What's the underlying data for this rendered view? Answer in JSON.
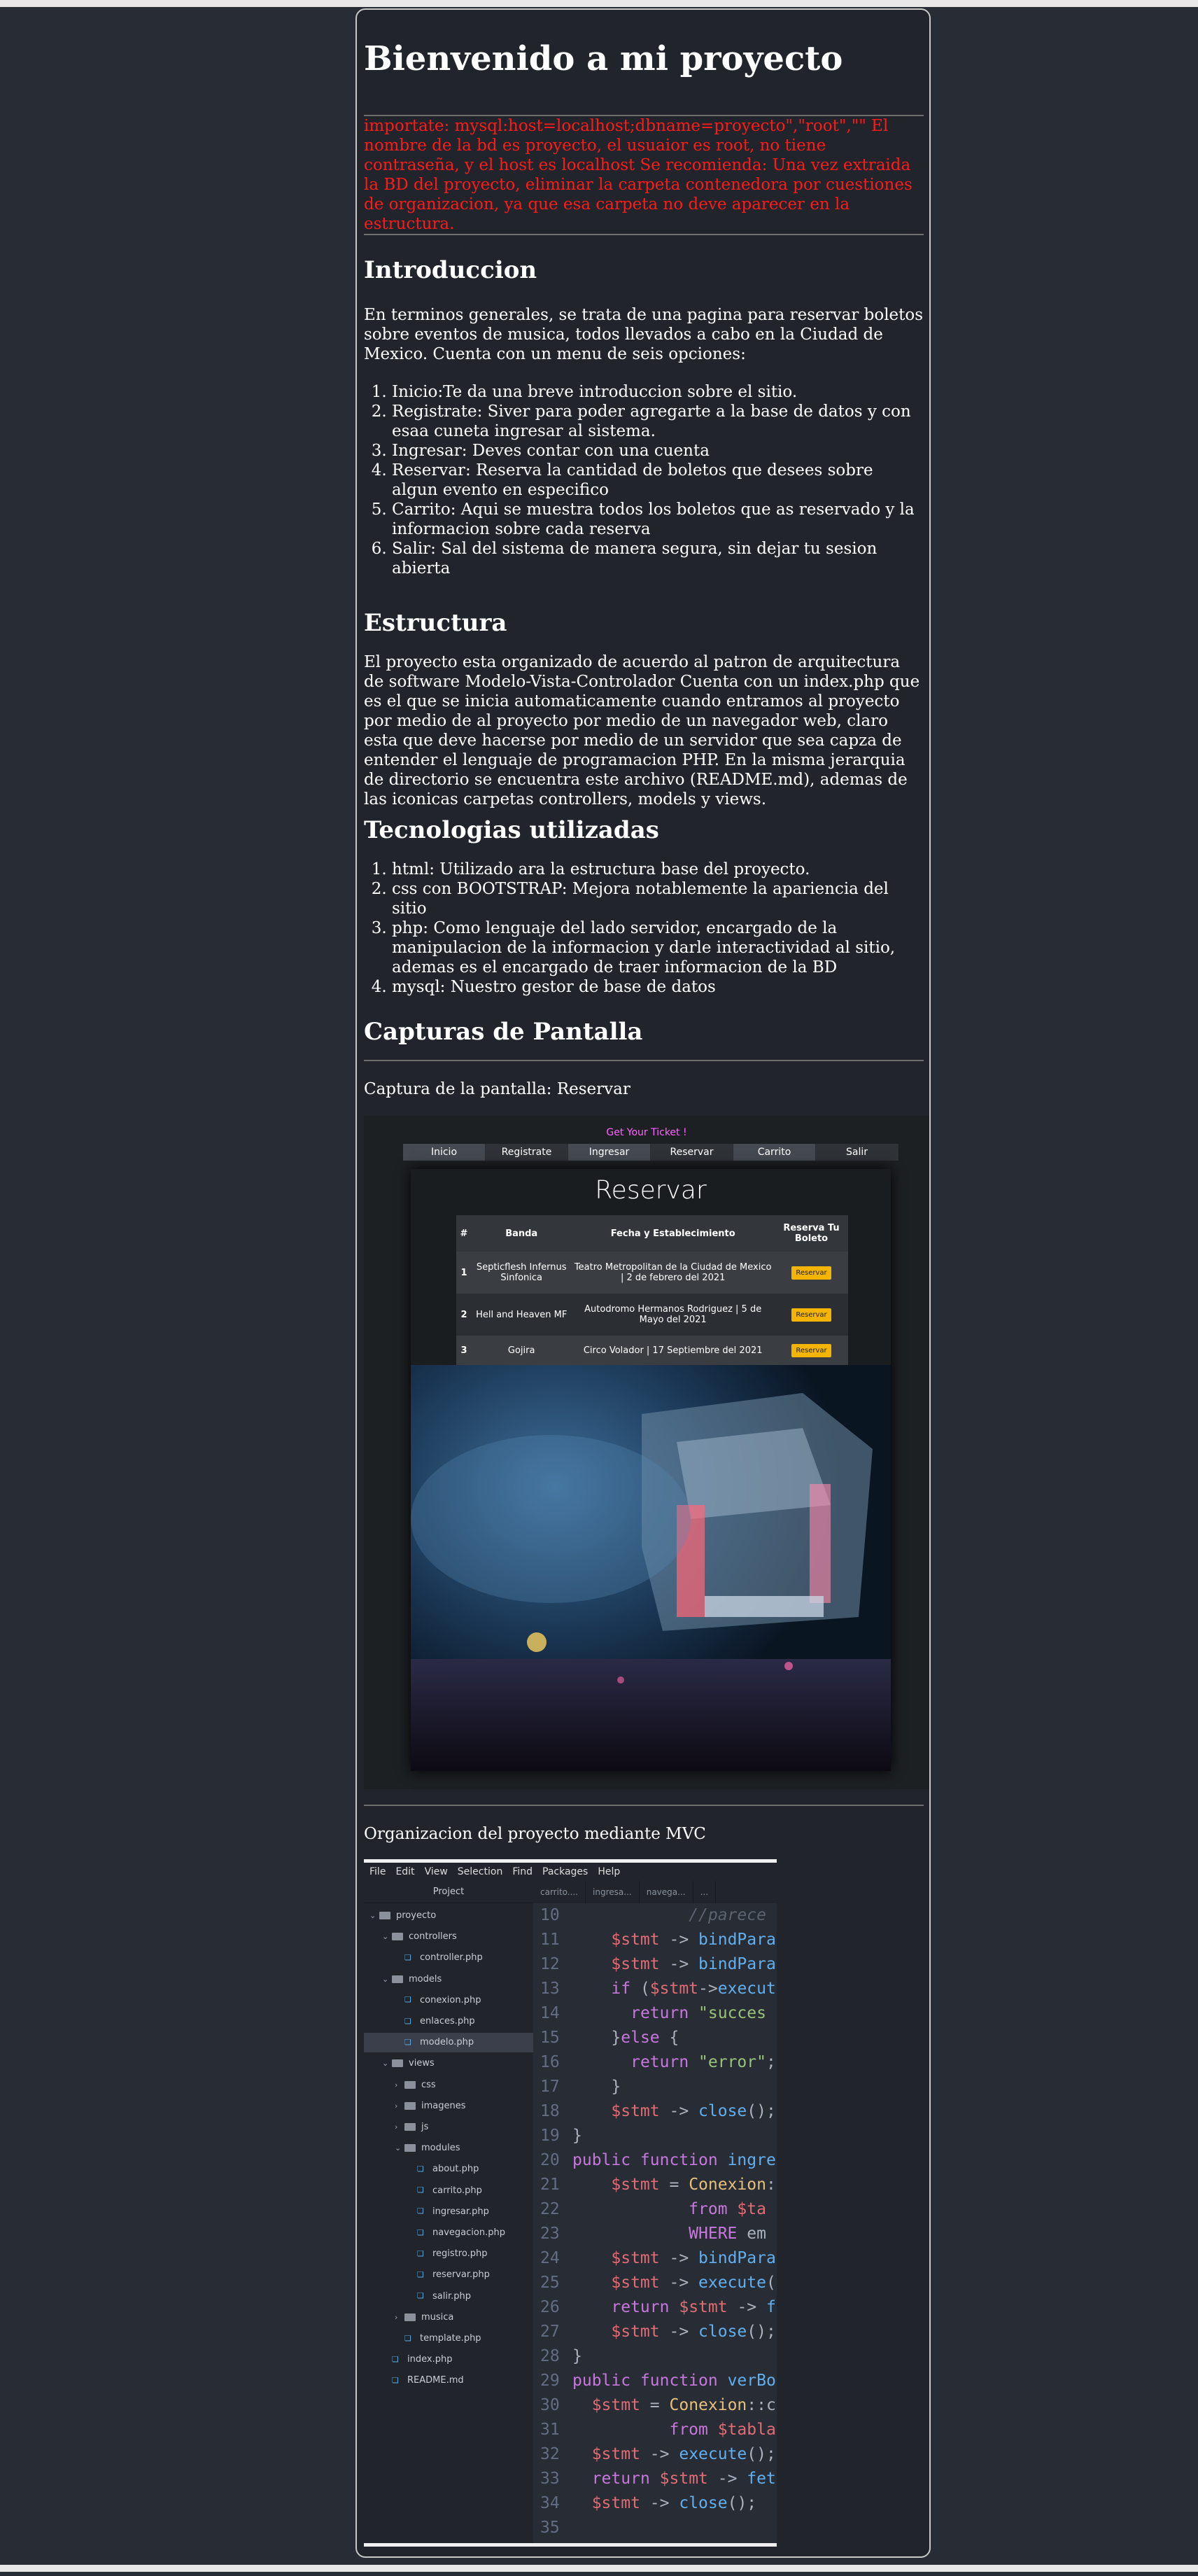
{
  "title": "Bienvenido a mi proyecto",
  "note": "importate: mysql:host=localhost;dbname=proyecto\",\"root\",\"\" El nombre de la bd es proyecto, el usuaior es root, no tiene contraseña, y el host es localhost Se recomienda: Una vez extraida la BD del proyecto, eliminar la carpeta contenedora por cuestiones de organizacion, ya que esa carpeta no deve aparecer en la estructura.",
  "intro": {
    "heading": "Introduccion",
    "text": "En terminos generales, se trata de una pagina para reservar boletos sobre eventos de musica, todos llevados a cabo en la Ciudad de Mexico. Cuenta con un menu de seis opciones:",
    "items": [
      "Inicio:Te da una breve introduccion sobre el sitio.",
      "Registrate: Siver para poder agregarte a la base de datos y con esaa cuneta ingresar al sistema.",
      "Ingresar: Deves contar con una cuenta",
      "Reservar: Reserva la cantidad de boletos que desees sobre algun evento en especifico",
      "Carrito: Aqui se muestra todos los boletos que as reservado y la informacion sobre cada reserva",
      "Salir: Sal del sistema de manera segura, sin dejar tu sesion abierta"
    ]
  },
  "estructura": {
    "heading": "Estructura",
    "text": "El proyecto esta organizado de acuerdo al patron de arquitectura de software Modelo-Vista-Controlador Cuenta con un index.php que es el que se inicia automaticamente cuando entramos al proyecto por medio de al proyecto por medio de un navegador web, claro esta que deve hacerse por medio de un servidor que sea capza de entender el lenguaje de programacion PHP. En la misma jerarquia de directorio se encuentra este archivo (README.md), ademas de las iconicas carpetas controllers, models y views."
  },
  "tecnologias": {
    "heading": "Tecnologias utilizadas",
    "items": [
      "html: Utilizado ara la estructura base del proyecto.",
      "css con BOOTSTRAP: Mejora notablemente la apariencia del sitio",
      "php: Como lenguaje del lado servidor, encargado de la manipulacion de la informacion y darle interactividad al sitio, ademas es el encargado de traer informacion de la BD",
      "mysql: Nuestro gestor de base de datos"
    ]
  },
  "capturas": {
    "heading": "Capturas de Pantalla",
    "caption1": "Captura de la pantalla: Reservar",
    "caption2": "Organizacion del proyecto mediante MVC"
  },
  "reservar_shot": {
    "banner": "Get Your Ticket !",
    "nav": [
      "Inicio",
      "Registrate",
      "Ingresar",
      "Reservar",
      "Carrito",
      "Salir"
    ],
    "title": "Reservar",
    "columns": [
      "#",
      "Banda",
      "Fecha y Establecimiento",
      "Reserva Tu Boleto"
    ],
    "rows": [
      {
        "num": "1",
        "banda": "Septicflesh Infernus Sinfonica",
        "fecha": "Teatro Metropolitan de la Ciudad de Mexico | 2 de febrero del 2021",
        "btn": "Reservar"
      },
      {
        "num": "2",
        "banda": "Hell and Heaven MF",
        "fecha": "Autodromo Hermanos Rodriguez | 5 de Mayo del 2021",
        "btn": "Reservar"
      },
      {
        "num": "3",
        "banda": "Gojira",
        "fecha": "Circo Volador | 17 Septiembre del 2021",
        "btn": "Reservar"
      }
    ],
    "btn_color": "#f4b400"
  },
  "editor_shot": {
    "menu": [
      "File",
      "Edit",
      "View",
      "Selection",
      "Find",
      "Packages",
      "Help"
    ],
    "tree_title": "Project",
    "tabs": [
      "carrito....",
      "ingresa...",
      "navega...",
      "..."
    ],
    "tree": [
      {
        "label": "proyecto",
        "type": "folder",
        "open": true
      },
      {
        "label": "controllers",
        "type": "folder",
        "open": true
      },
      {
        "label": "controller.php",
        "type": "file"
      },
      {
        "label": "models",
        "type": "folder",
        "open": true
      },
      {
        "label": "conexion.php",
        "type": "file"
      },
      {
        "label": "enlaces.php",
        "type": "file"
      },
      {
        "label": "modelo.php",
        "type": "file",
        "selected": true
      },
      {
        "label": "views",
        "type": "folder",
        "open": true
      },
      {
        "label": "css",
        "type": "folder"
      },
      {
        "label": "imagenes",
        "type": "folder"
      },
      {
        "label": "js",
        "type": "folder"
      },
      {
        "label": "modules",
        "type": "folder",
        "open": true
      },
      {
        "label": "about.php",
        "type": "file"
      },
      {
        "label": "carrito.php",
        "type": "file"
      },
      {
        "label": "ingresar.php",
        "type": "file"
      },
      {
        "label": "navegacion.php",
        "type": "file"
      },
      {
        "label": "registro.php",
        "type": "file"
      },
      {
        "label": "reservar.php",
        "type": "file"
      },
      {
        "label": "salir.php",
        "type": "file"
      },
      {
        "label": "musica",
        "type": "folder"
      },
      {
        "label": "template.php",
        "type": "file"
      },
      {
        "label": "index.php",
        "type": "file"
      },
      {
        "label": "README.md",
        "type": "file"
      }
    ],
    "code": [
      {
        "n": "10",
        "t": [
          [
            "cm",
            "            //parece"
          ]
        ]
      },
      {
        "n": "11",
        "t": [
          [
            "pl",
            "    "
          ],
          [
            "var",
            "$stmt"
          ],
          [
            "pl",
            " -> "
          ],
          [
            "fn",
            "bindPara"
          ]
        ]
      },
      {
        "n": "12",
        "t": [
          [
            "pl",
            "    "
          ],
          [
            "var",
            "$stmt"
          ],
          [
            "pl",
            " -> "
          ],
          [
            "fn",
            "bindPara"
          ]
        ]
      },
      {
        "n": "13",
        "t": [
          [
            "pl",
            "    "
          ],
          [
            "kw",
            "if"
          ],
          [
            "pl",
            " ("
          ],
          [
            "var",
            "$stmt"
          ],
          [
            "pl",
            "->"
          ],
          [
            "fn",
            "executi"
          ]
        ]
      },
      {
        "n": "14",
        "t": [
          [
            "pl",
            "      "
          ],
          [
            "kw",
            "return"
          ],
          [
            "pl",
            " "
          ],
          [
            "str",
            "\"succes"
          ]
        ]
      },
      {
        "n": "15",
        "t": [
          [
            "pl",
            "    }"
          ],
          [
            "kw",
            "else"
          ],
          [
            "pl",
            " {"
          ]
        ]
      },
      {
        "n": "16",
        "t": [
          [
            "pl",
            "      "
          ],
          [
            "kw",
            "return"
          ],
          [
            "pl",
            " "
          ],
          [
            "str",
            "\"error\""
          ],
          [
            "pl",
            ";"
          ]
        ]
      },
      {
        "n": "17",
        "t": [
          [
            "pl",
            "    }"
          ]
        ]
      },
      {
        "n": "18",
        "t": [
          [
            "pl",
            "    "
          ],
          [
            "var",
            "$stmt"
          ],
          [
            "pl",
            " -> "
          ],
          [
            "fn",
            "close"
          ],
          [
            "pl",
            "();"
          ]
        ]
      },
      {
        "n": "19",
        "t": [
          [
            "pl",
            "}"
          ]
        ]
      },
      {
        "n": "20",
        "t": [
          [
            "kw",
            "public function"
          ],
          [
            "pl",
            " "
          ],
          [
            "fn",
            "ingre"
          ]
        ]
      },
      {
        "n": "21",
        "t": [
          [
            "pl",
            "    "
          ],
          [
            "var",
            "$stmt"
          ],
          [
            "pl",
            " = "
          ],
          [
            "cls",
            "Conexion"
          ],
          [
            "pl",
            ":"
          ]
        ]
      },
      {
        "n": "22",
        "t": [
          [
            "pl",
            "            "
          ],
          [
            "kw",
            "from"
          ],
          [
            "pl",
            " "
          ],
          [
            "var",
            "$ta"
          ]
        ]
      },
      {
        "n": "23",
        "t": [
          [
            "pl",
            "            "
          ],
          [
            "kw",
            "WHERE"
          ],
          [
            "pl",
            " em"
          ]
        ]
      },
      {
        "n": "24",
        "t": [
          [
            "pl",
            "    "
          ],
          [
            "var",
            "$stmt"
          ],
          [
            "pl",
            " -> "
          ],
          [
            "fn",
            "bindPara"
          ]
        ]
      },
      {
        "n": "25",
        "t": [
          [
            "pl",
            "    "
          ],
          [
            "var",
            "$stmt"
          ],
          [
            "pl",
            " -> "
          ],
          [
            "fn",
            "execute"
          ],
          [
            "pl",
            "("
          ]
        ]
      },
      {
        "n": "26",
        "t": [
          [
            "pl",
            "    "
          ],
          [
            "kw",
            "return"
          ],
          [
            "pl",
            " "
          ],
          [
            "var",
            "$stmt"
          ],
          [
            "pl",
            " -> "
          ],
          [
            "fn",
            "f"
          ]
        ]
      },
      {
        "n": "27",
        "t": [
          [
            "pl",
            "    "
          ],
          [
            "var",
            "$stmt"
          ],
          [
            "pl",
            " -> "
          ],
          [
            "fn",
            "close"
          ],
          [
            "pl",
            "();"
          ]
        ]
      },
      {
        "n": "28",
        "t": [
          [
            "pl",
            "}"
          ]
        ]
      },
      {
        "n": "29",
        "t": [
          [
            "kw",
            "public function"
          ],
          [
            "pl",
            " "
          ],
          [
            "fn",
            "verBo"
          ]
        ]
      },
      {
        "n": "30",
        "t": [
          [
            "pl",
            "  "
          ],
          [
            "var",
            "$stmt"
          ],
          [
            "pl",
            " = "
          ],
          [
            "cls",
            "Conexion"
          ],
          [
            "pl",
            "::c"
          ]
        ]
      },
      {
        "n": "31",
        "t": [
          [
            "pl",
            "          "
          ],
          [
            "kw",
            "from"
          ],
          [
            "pl",
            " "
          ],
          [
            "var",
            "$tabla"
          ]
        ]
      },
      {
        "n": "32",
        "t": [
          [
            "pl",
            "  "
          ],
          [
            "var",
            "$stmt"
          ],
          [
            "pl",
            " -> "
          ],
          [
            "fn",
            "execute"
          ],
          [
            "pl",
            "();"
          ]
        ]
      },
      {
        "n": "33",
        "t": [
          [
            "pl",
            "  "
          ],
          [
            "kw",
            "return"
          ],
          [
            "pl",
            " "
          ],
          [
            "var",
            "$stmt"
          ],
          [
            "pl",
            " -> "
          ],
          [
            "fn",
            "fet"
          ]
        ]
      },
      {
        "n": "34",
        "t": [
          [
            "pl",
            "  "
          ],
          [
            "var",
            "$stmt"
          ],
          [
            "pl",
            " -> "
          ],
          [
            "fn",
            "close"
          ],
          [
            "pl",
            "();"
          ]
        ]
      },
      {
        "n": "35",
        "t": []
      }
    ]
  }
}
